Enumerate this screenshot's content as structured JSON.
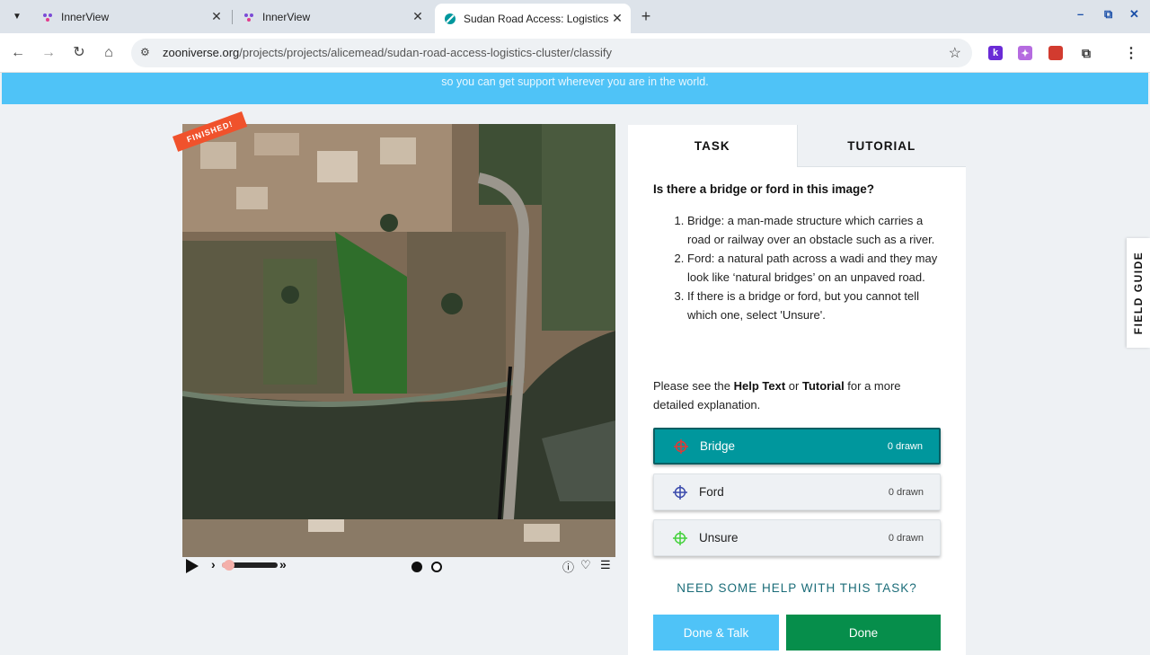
{
  "browser": {
    "tabs": [
      {
        "title": "InnerView",
        "active": false
      },
      {
        "title": "InnerView",
        "active": false
      },
      {
        "title": "Sudan Road Access: Logistics",
        "active": true
      }
    ],
    "url_domain": "zooniverse.org",
    "url_path": "/projects/projects/alicemead/sudan-road-access-logistics-cluster/classify",
    "new_tab_label": "+",
    "window_controls": {
      "minimize": "–",
      "restore": "⧉",
      "close": "✕"
    }
  },
  "banner": {
    "text": "so you can get support wherever you are in the world."
  },
  "subject": {
    "finished_label": "FINISHED!",
    "viewer_progress": 0.1
  },
  "task_panel": {
    "tabs": [
      {
        "label": "TASK",
        "active": true
      },
      {
        "label": "TUTORIAL",
        "active": false
      }
    ],
    "question": "Is there a bridge or ford in this image?",
    "instructions": [
      "Bridge: a man-made structure which carries a road or railway over an obstacle such as a river.",
      "Ford: a natural path across a wadi and they may look like ‘natural bridges’ on an unpaved road.",
      "If there is a bridge or ford, but you cannot tell which one, select 'Unsure'."
    ],
    "help_prefix": "Please see the ",
    "help_text_bold": "Help Text",
    "help_or": " or ",
    "tutorial_bold": "Tutorial",
    "help_suffix": " for a more detailed explanation.",
    "tools": [
      {
        "label": "Bridge",
        "count": "0 drawn",
        "color": "#e53935",
        "active": true
      },
      {
        "label": "Ford",
        "count": "0 drawn",
        "color": "#3949ab",
        "active": false
      },
      {
        "label": "Unsure",
        "count": "0 drawn",
        "color": "#43d13b",
        "active": false
      }
    ],
    "need_help": "NEED SOME HELP WITH THIS TASK?",
    "done_talk": "Done & Talk",
    "done": "Done"
  },
  "field_guide": {
    "label": "FIELD GUIDE"
  },
  "colors": {
    "banner": "#4fc3f7",
    "active_tool": "#00979d",
    "done": "#068e4b",
    "finished": "#f0522c"
  }
}
